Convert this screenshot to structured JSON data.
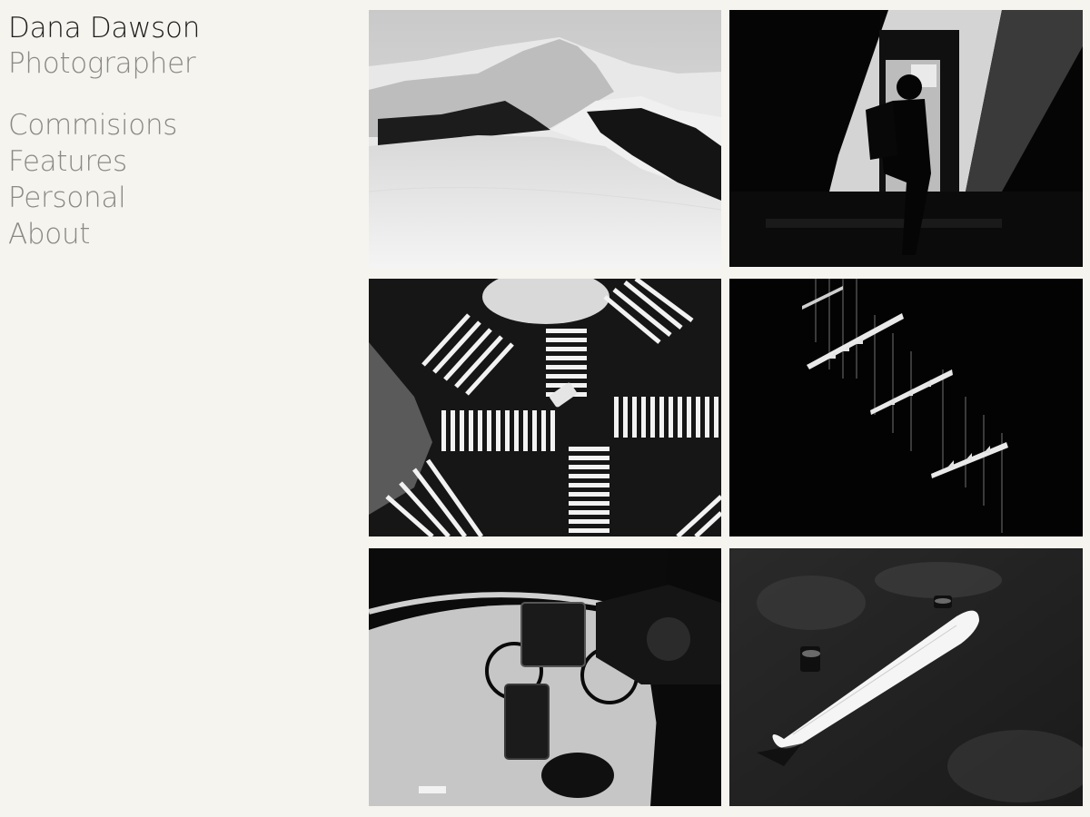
{
  "header": {
    "name": "Dana Dawson",
    "role": "Photographer"
  },
  "nav": {
    "items": [
      {
        "label": "Commisions"
      },
      {
        "label": "Features"
      },
      {
        "label": "Personal"
      },
      {
        "label": "About"
      }
    ]
  },
  "gallery": {
    "photos": [
      {
        "subject": "sand-dunes"
      },
      {
        "subject": "silhouette-walker"
      },
      {
        "subject": "crosswalk-aerial"
      },
      {
        "subject": "stair-shadows"
      },
      {
        "subject": "cyclist-overhead"
      },
      {
        "subject": "skateboard"
      }
    ]
  },
  "colors": {
    "background": "#f5f4ef",
    "name_text": "#1f1f1d",
    "muted_text": "#8a8984"
  }
}
